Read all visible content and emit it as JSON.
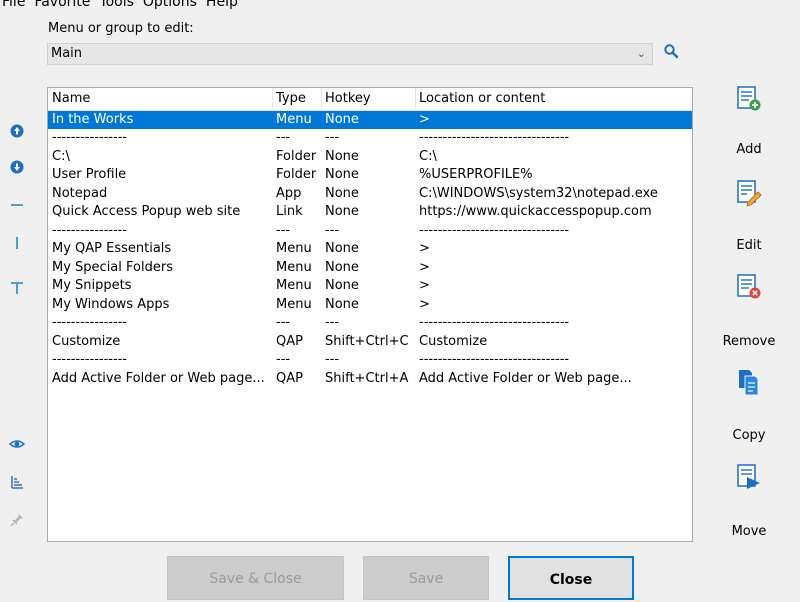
{
  "menubar": [
    "File",
    "Favorite",
    "Tools",
    "Options",
    "Help"
  ],
  "edit_label": "Menu or group to edit:",
  "dropdown_value": "Main",
  "columns": [
    "Name",
    "Type",
    "Hotkey",
    "Location or content"
  ],
  "rows": [
    {
      "name": "In the Works",
      "type": "Menu",
      "hotkey": "None",
      "location": ">"
    },
    {
      "name": "----------------",
      "type": "---",
      "hotkey": "---",
      "location": "--------------------------------"
    },
    {
      "name": "C:\\",
      "type": "Folder",
      "hotkey": "None",
      "location": "C:\\"
    },
    {
      "name": "User Profile",
      "type": "Folder",
      "hotkey": "None",
      "location": "%USERPROFILE%"
    },
    {
      "name": "Notepad",
      "type": "App",
      "hotkey": "None",
      "location": "C:\\WINDOWS\\system32\\notepad.exe"
    },
    {
      "name": "Quick Access Popup web site",
      "type": "Link",
      "hotkey": "None",
      "location": "https://www.quickaccesspopup.com"
    },
    {
      "name": "----------------",
      "type": "---",
      "hotkey": "---",
      "location": "--------------------------------"
    },
    {
      "name": "My QAP Essentials",
      "type": "Menu",
      "hotkey": "None",
      "location": ">"
    },
    {
      "name": "My Special Folders",
      "type": "Menu",
      "hotkey": "None",
      "location": ">"
    },
    {
      "name": "My Snippets",
      "type": "Menu",
      "hotkey": "None",
      "location": ">"
    },
    {
      "name": "My Windows Apps",
      "type": "Menu",
      "hotkey": "None",
      "location": ">"
    },
    {
      "name": "----------------",
      "type": "---",
      "hotkey": "---",
      "location": "--------------------------------"
    },
    {
      "name": "Customize",
      "type": "QAP",
      "hotkey": "Shift+Ctrl+C",
      "location": "Customize"
    },
    {
      "name": "----------------",
      "type": "---",
      "hotkey": "---",
      "location": "--------------------------------"
    },
    {
      "name": "Add Active Folder or Web page...",
      "type": "QAP",
      "hotkey": "Shift+Ctrl+A",
      "location": "Add Active Folder or Web page..."
    }
  ],
  "right_buttons": {
    "add": "Add",
    "edit": "Edit",
    "remove": "Remove",
    "copy": "Copy",
    "move": "Move"
  },
  "bottom_buttons": {
    "save_close": "Save & Close",
    "save": "Save",
    "close": "Close"
  },
  "left_icons": [
    "move-up-icon",
    "move-down-icon",
    "separator-icon",
    "column-break-icon",
    "text-separator-icon",
    "preview-icon",
    "sort-icon",
    "pin-icon"
  ],
  "colors": {
    "accent": "#0078d7",
    "icon_blue": "#1e6fc4",
    "selection": "#0078d7"
  }
}
